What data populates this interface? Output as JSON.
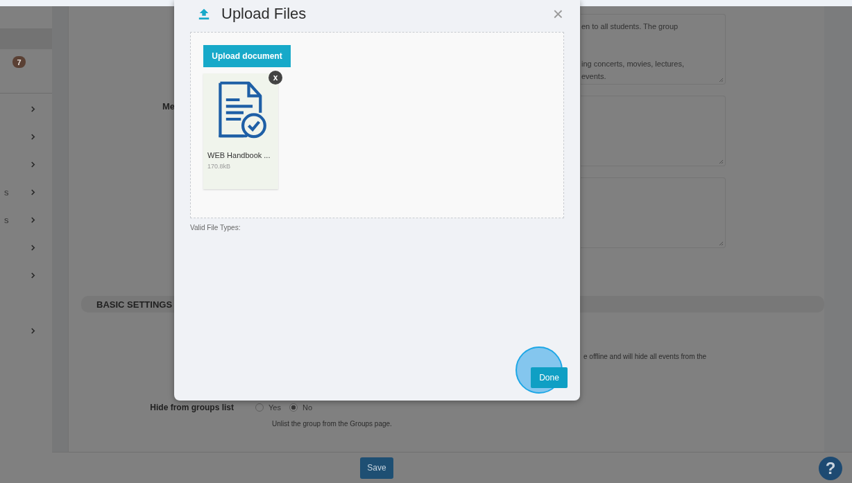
{
  "sidebar": {
    "top_items": [
      {
        "selected": true
      },
      {
        "selected": false,
        "badge": "7"
      }
    ],
    "items": [
      {
        "expandable": true
      },
      {
        "expandable": true
      },
      {
        "expandable": true
      },
      {
        "label": "s",
        "expandable": true
      },
      {
        "label": "s",
        "expandable": true
      },
      {
        "expandable": true
      },
      {
        "expandable": true
      },
      {
        "expandable": true
      }
    ]
  },
  "form": {
    "fields": [
      {
        "kind": "textarea",
        "lines": [
          "en to all students. The group",
          "ing concerts, movies, lectures,",
          "events."
        ]
      },
      {
        "kind": "textarea",
        "label": "Me"
      },
      {
        "kind": "textarea"
      }
    ],
    "section_title": "BASIC SETTINGS",
    "offline_note": "e offline and will hide all events from the",
    "settings": [
      {
        "label": "Hide from groups list",
        "options": [
          {
            "label": "Yes",
            "selected": false
          },
          {
            "label": "No",
            "selected": true
          }
        ],
        "help": "Unlist the group from the Groups page."
      }
    ]
  },
  "footer": {
    "save": "Save",
    "help": "?"
  },
  "dialog": {
    "title": "Upload Files",
    "close": "×",
    "upload_button": "Upload document",
    "files": [
      {
        "name": "WEB Handbook ...",
        "size": "170.8kB",
        "remove": "x"
      }
    ],
    "valid_types_label": "Valid File Types:",
    "done": "Done"
  }
}
